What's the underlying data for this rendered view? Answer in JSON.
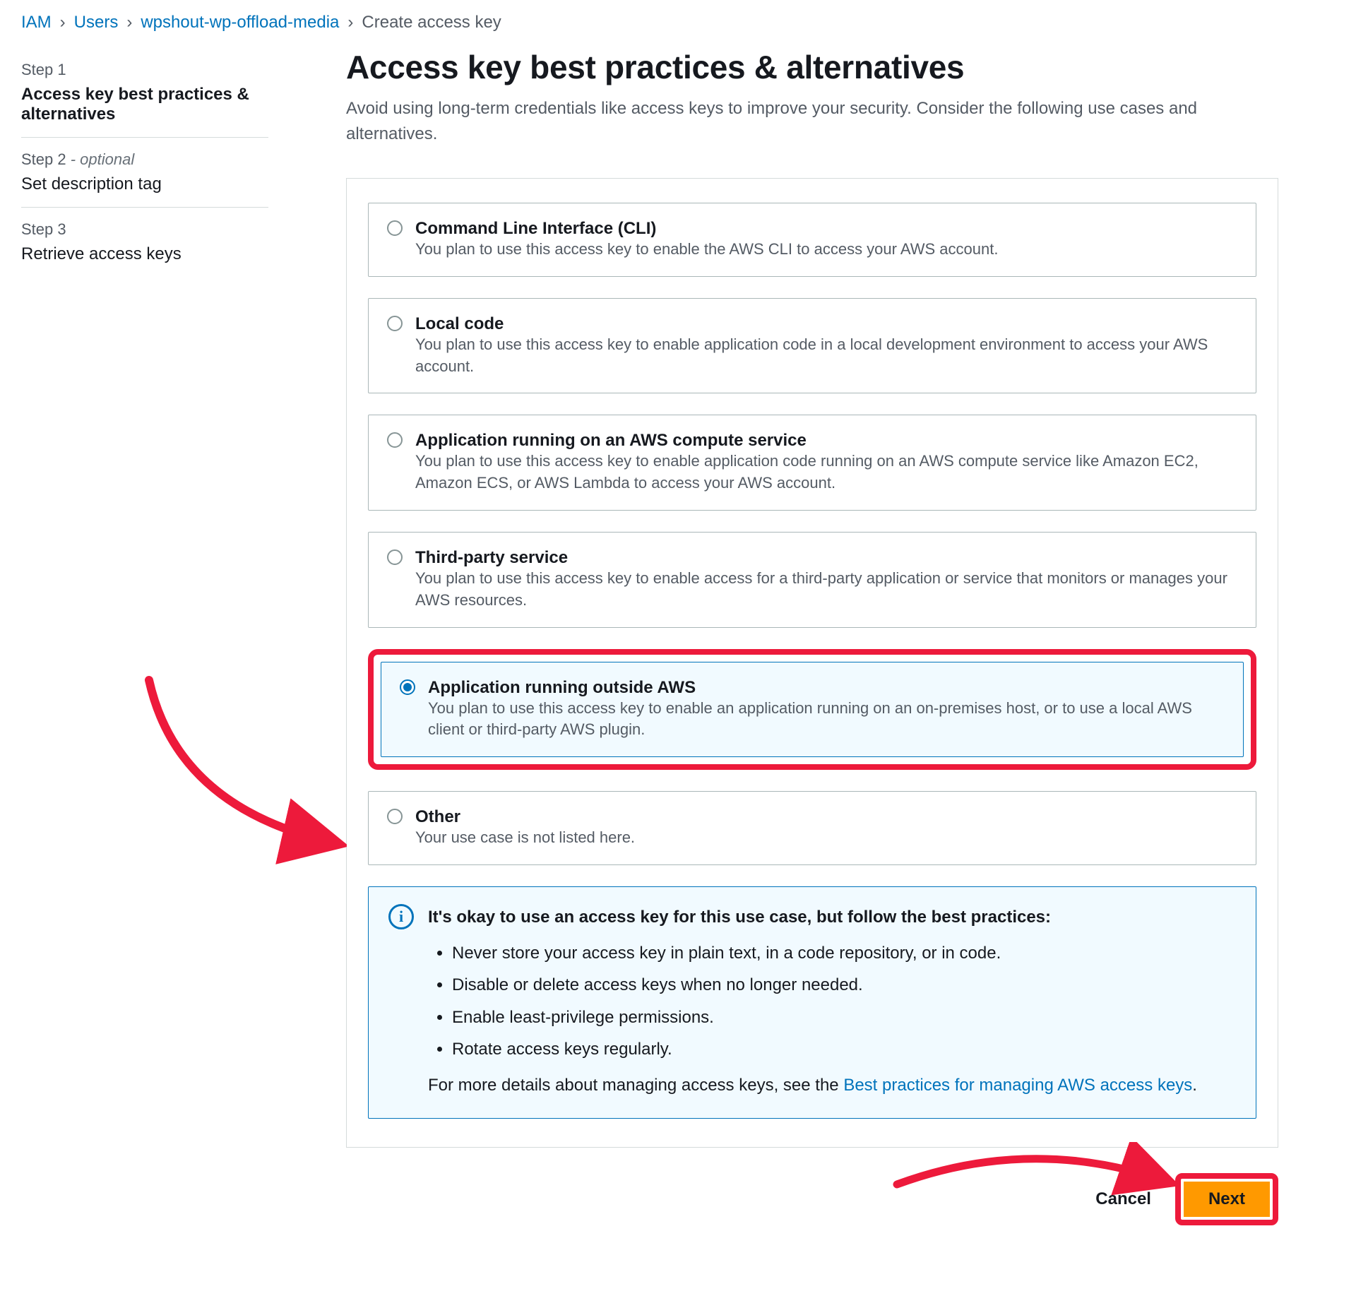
{
  "breadcrumb": {
    "items": [
      {
        "label": "IAM",
        "link": true
      },
      {
        "label": "Users",
        "link": true
      },
      {
        "label": "wpshout-wp-offload-media",
        "link": true
      },
      {
        "label": "Create access key",
        "link": false
      }
    ]
  },
  "sidebar": {
    "steps": [
      {
        "label": "Step 1",
        "optional": "",
        "title": "Access key best practices & alternatives",
        "active": true
      },
      {
        "label": "Step 2",
        "optional": " - optional",
        "title": "Set description tag",
        "active": false
      },
      {
        "label": "Step 3",
        "optional": "",
        "title": "Retrieve access keys",
        "active": false
      }
    ]
  },
  "main": {
    "title": "Access key best practices & alternatives",
    "description": "Avoid using long-term credentials like access keys to improve your security. Consider the following use cases and alternatives.",
    "options": [
      {
        "title": "Command Line Interface (CLI)",
        "desc": "You plan to use this access key to enable the AWS CLI to access your AWS account.",
        "selected": false
      },
      {
        "title": "Local code",
        "desc": "You plan to use this access key to enable application code in a local development environment to access your AWS account.",
        "selected": false
      },
      {
        "title": "Application running on an AWS compute service",
        "desc": "You plan to use this access key to enable application code running on an AWS compute service like Amazon EC2, Amazon ECS, or AWS Lambda to access your AWS account.",
        "selected": false
      },
      {
        "title": "Third-party service",
        "desc": "You plan to use this access key to enable access for a third-party application or service that monitors or manages your AWS resources.",
        "selected": false
      },
      {
        "title": "Application running outside AWS",
        "desc": "You plan to use this access key to enable an application running on an on-premises host, or to use a local AWS client or third-party AWS plugin.",
        "selected": true
      },
      {
        "title": "Other",
        "desc": "Your use case is not listed here.",
        "selected": false
      }
    ],
    "info": {
      "title": "It's okay to use an access key for this use case, but follow the best practices:",
      "bullets": [
        "Never store your access key in plain text, in a code repository, or in code.",
        "Disable or delete access keys when no longer needed.",
        "Enable least-privilege permissions.",
        "Rotate access keys regularly."
      ],
      "more_start": "For more details about managing access keys, see the ",
      "more_link": "Best practices for managing AWS access keys",
      "more_end": "."
    },
    "actions": {
      "cancel": "Cancel",
      "next": "Next"
    }
  }
}
